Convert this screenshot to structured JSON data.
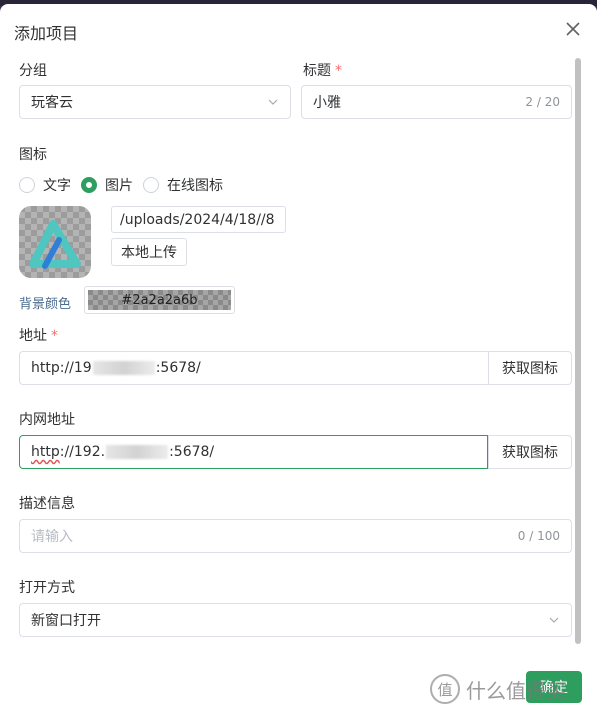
{
  "dialog": {
    "title": "添加项目",
    "close_icon": "close-icon"
  },
  "group": {
    "label": "分组",
    "value": "玩客云",
    "icon": "chevron-down-icon"
  },
  "title_field": {
    "label": "标题",
    "required_mark": "*",
    "value": "小雅",
    "counter": "2 / 20"
  },
  "icon_section": {
    "label": "图标",
    "options": [
      "文字",
      "图片",
      "在线图标"
    ],
    "selected": "图片",
    "path": "/uploads/2024/4/18//8",
    "upload_label": "本地上传",
    "bg_color_label": "背景颜色",
    "bg_color_value": "#2a2a2a6b"
  },
  "address": {
    "label": "地址",
    "required_mark": "*",
    "value_prefix": "http://19",
    "value_suffix": ":5678/",
    "button": "获取图标"
  },
  "lan_address": {
    "label": "内网地址",
    "value_prefix": "http",
    "value_mid": "://192.",
    "value_suffix": ":5678/",
    "button": "获取图标"
  },
  "description": {
    "label": "描述信息",
    "placeholder": "请输入",
    "counter": "0 / 100"
  },
  "open_mode": {
    "label": "打开方式",
    "value": "新窗口打开",
    "icon": "chevron-down-icon"
  },
  "footer": {
    "submit_label": "确定",
    "watermark": "什么值得买",
    "watermark_icon": "值"
  },
  "colors": {
    "accent": "#2e9e5e",
    "required": "#f56c6c",
    "border": "#dcdfe6"
  }
}
